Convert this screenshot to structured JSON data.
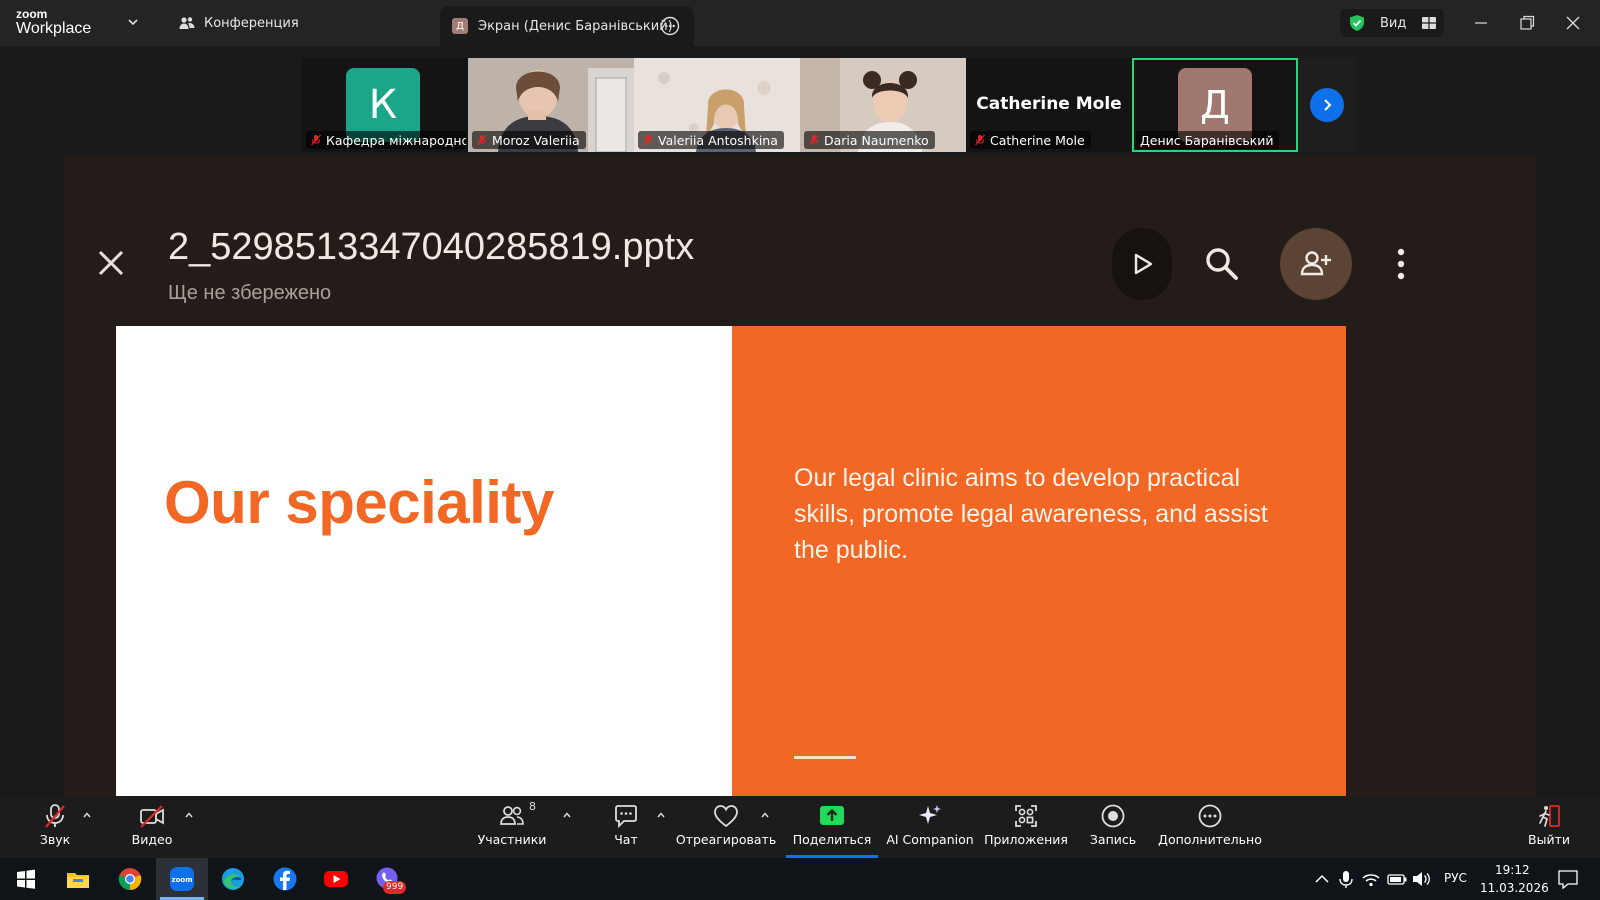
{
  "window": {
    "brand_top": "zoom",
    "brand_bottom": "Workplace",
    "conference_label": "Конференция",
    "share_tab_badge": "Д",
    "share_tab_label": "Экран (Денис Баранівський)",
    "view_label": "Вид"
  },
  "participants": [
    {
      "name": "Кафедра міжнародно...",
      "initial": "К",
      "kind": "avatar",
      "muted": true
    },
    {
      "name": "Moroz Valeriia",
      "kind": "video",
      "muted": true
    },
    {
      "name": "Valeriia Antoshkina",
      "kind": "video",
      "muted": true
    },
    {
      "name": "Daria Naumenko",
      "kind": "video",
      "muted": true
    },
    {
      "name": "Catherine Mole",
      "big_name": "Catherine Mole",
      "kind": "name",
      "muted": true
    },
    {
      "name": "Денис Баранівський",
      "initial": "Д",
      "kind": "avatar",
      "muted": false,
      "active": true
    }
  ],
  "shared_screen": {
    "file_name": "2_5298513347040285819.pptx",
    "file_status": "Ще не збережено",
    "slide": {
      "heading": "Our speciality",
      "body": "Our legal clinic aims to develop practical skills, promote legal awareness, and assist the public."
    }
  },
  "toolbar": {
    "audio": "Звук",
    "video": "Видео",
    "participants": "Участники",
    "participants_count": "8",
    "chat": "Чат",
    "react": "Отреагировать",
    "share": "Поделиться",
    "ai_companion": "AI Companion",
    "apps": "Приложения",
    "record": "Запись",
    "more": "Дополнительно",
    "leave": "Выйти"
  },
  "taskbar": {
    "language": "РУС",
    "time": "19:12",
    "date": "11.03.2026",
    "viber_badge": "999"
  },
  "colors": {
    "zoom_blue": "#0e71eb",
    "active_speaker": "#29d47c",
    "slide_orange": "#f26724",
    "avatar_teal": "#1ba68a",
    "avatar_mauve": "#a1786e",
    "share_green": "#23d959"
  }
}
